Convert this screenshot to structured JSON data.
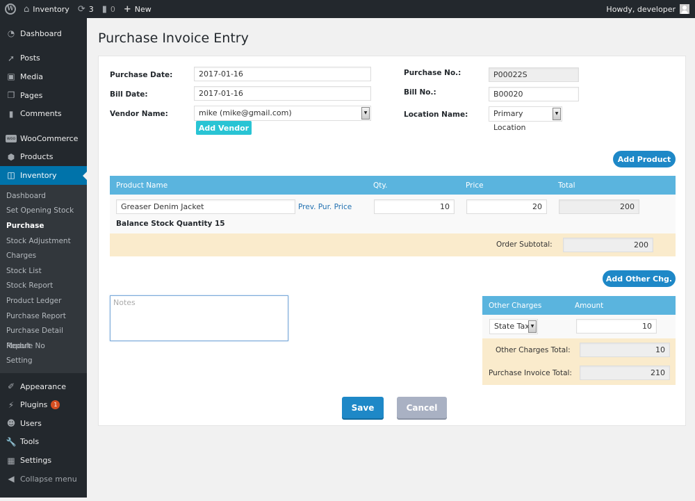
{
  "admin_bar": {
    "site_name": "Inventory",
    "updates_count": "3",
    "comments_count": "0",
    "new_label": "New",
    "greeting": "Howdy, developer"
  },
  "sidebar": {
    "top_items": [
      {
        "label": "Dashboard",
        "icon": "dashboard-icon"
      },
      {
        "label": "Posts",
        "icon": "pin-icon"
      },
      {
        "label": "Media",
        "icon": "media-icon"
      },
      {
        "label": "Pages",
        "icon": "pages-icon"
      },
      {
        "label": "Comments",
        "icon": "comment-icon"
      },
      {
        "label": "WooCommerce",
        "icon": "woocommerce-icon"
      },
      {
        "label": "Products",
        "icon": "box-icon"
      },
      {
        "label": "Inventory",
        "icon": "inventory-icon"
      }
    ],
    "submenu": [
      "Dashboard",
      "Set Opening Stock",
      "Purchase",
      "Stock Adjustment",
      "Charges",
      "Stock List",
      "Stock Report",
      "Product Ledger",
      "Purchase Report",
      "Purchase Detail Report",
      "Module No",
      "Setting"
    ],
    "submenu_current": "Purchase",
    "bottom_items": [
      {
        "label": "Appearance",
        "icon": "brush-icon"
      },
      {
        "label": "Plugins",
        "icon": "plug-icon",
        "badge": "1"
      },
      {
        "label": "Users",
        "icon": "user-icon"
      },
      {
        "label": "Tools",
        "icon": "wrench-icon"
      },
      {
        "label": "Settings",
        "icon": "settings-icon"
      }
    ],
    "collapse_label": "Collapse menu"
  },
  "page": {
    "title": "Purchase Invoice Entry"
  },
  "form": {
    "purchase_date_label": "Purchase Date:",
    "purchase_date": "2017-01-16",
    "bill_date_label": "Bill Date:",
    "bill_date": "2017-01-16",
    "vendor_label": "Vendor Name:",
    "vendor": "mike (mike@gmail.com)",
    "add_vendor": "Add Vendor",
    "purchase_no_label": "Purchase No.:",
    "purchase_no": "P00022S",
    "bill_no_label": "Bill No.:",
    "bill_no": "B00020",
    "location_label": "Location Name:",
    "location": "Primary Location"
  },
  "products": {
    "add_button": "Add Product",
    "headers": {
      "name": "Product Name",
      "qty": "Qty.",
      "price": "Price",
      "total": "Total"
    },
    "rows": [
      {
        "name": "Greaser Denim Jacket",
        "prev_price_link": "Prev. Pur. Price",
        "qty": "10",
        "price": "20",
        "total": "200",
        "balance": "Balance Stock Quantity 15"
      }
    ],
    "subtotal_label": "Order Subtotal:",
    "subtotal": "200"
  },
  "notes": {
    "placeholder": "Notes"
  },
  "other_charges": {
    "add_button": "Add Other Chg.",
    "headers": {
      "charge": "Other Charges",
      "amount": "Amount"
    },
    "rows": [
      {
        "charge": "State Tax",
        "amount": "10"
      }
    ],
    "total_label": "Other Charges Total:",
    "total": "10",
    "invoice_total_label": "Purchase Invoice Total:",
    "invoice_total": "210"
  },
  "actions": {
    "save": "Save",
    "cancel": "Cancel"
  },
  "colors": {
    "accent": "#0073aa",
    "header_blue": "#5ab4de",
    "button_blue": "#1e88c7",
    "teal": "#29c4d4",
    "summary_bg": "#faebcc"
  }
}
